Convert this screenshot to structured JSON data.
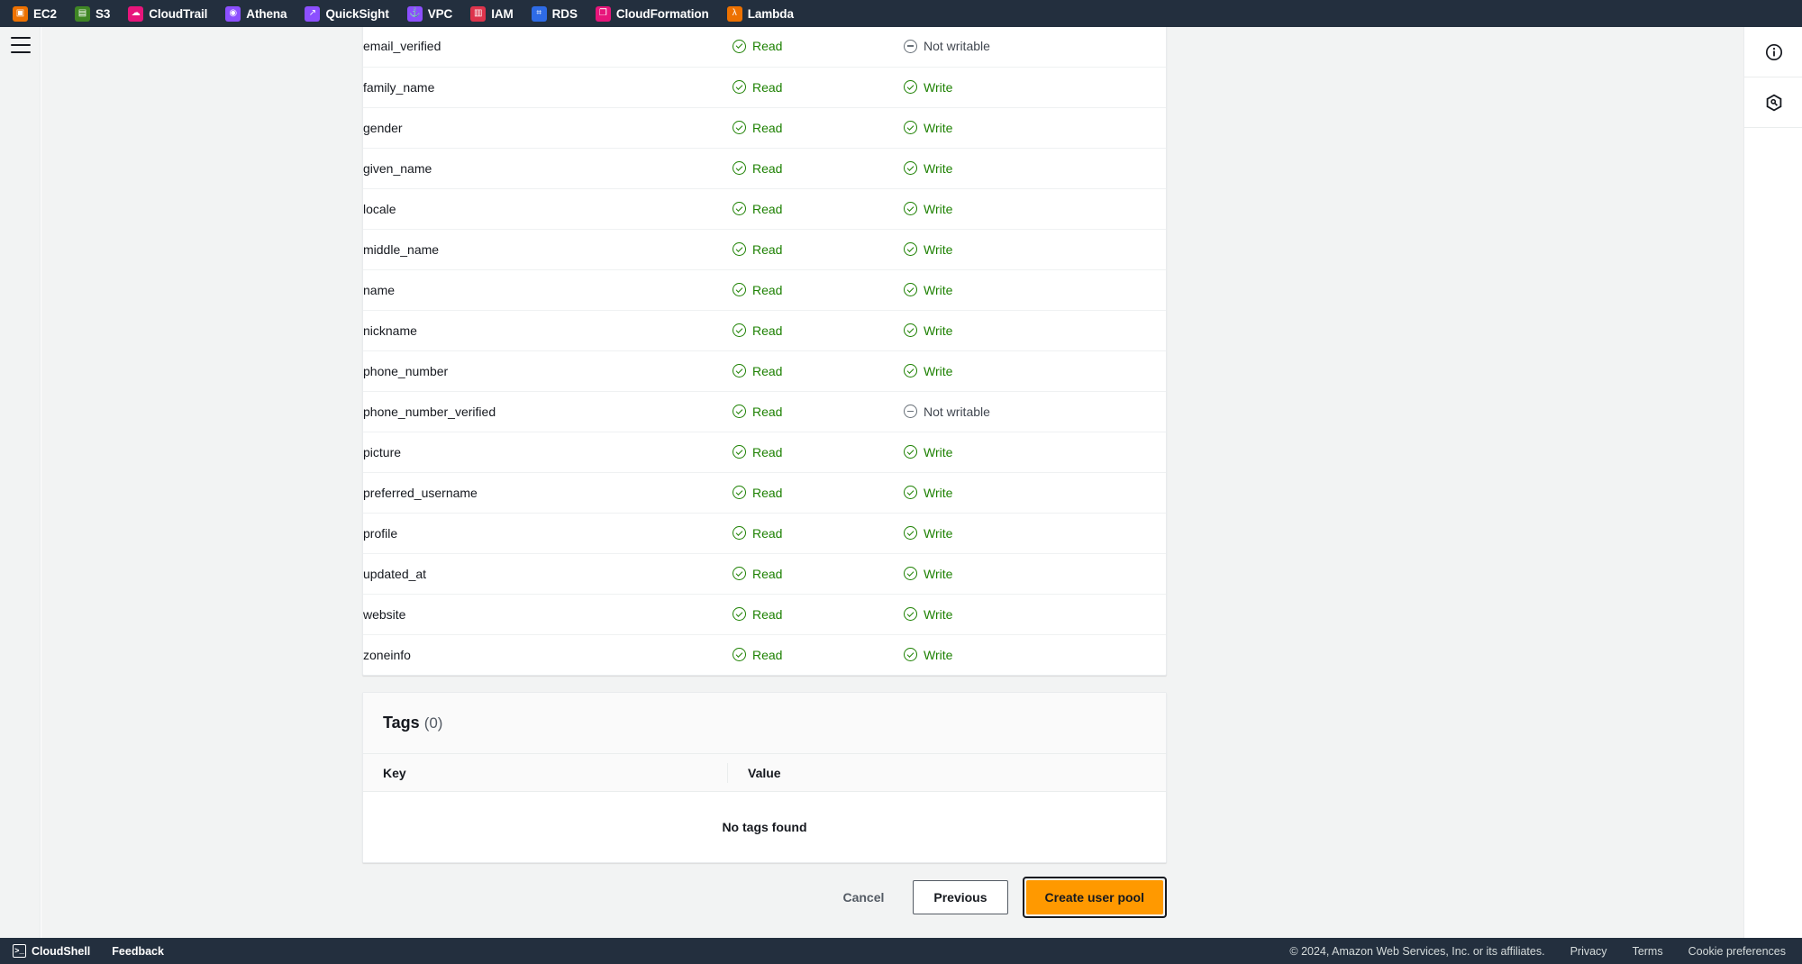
{
  "topnav": {
    "services": [
      {
        "label": "EC2",
        "icon": "ec2-icon",
        "color": "#ed7100",
        "glyph": "▣"
      },
      {
        "label": "S3",
        "icon": "s3-icon",
        "color": "#3f8624",
        "glyph": "▤"
      },
      {
        "label": "CloudTrail",
        "icon": "cloudtrail-icon",
        "color": "#e7157b",
        "glyph": "☁"
      },
      {
        "label": "Athena",
        "icon": "athena-icon",
        "color": "#8c4fff",
        "glyph": "◉"
      },
      {
        "label": "QuickSight",
        "icon": "quicksight-icon",
        "color": "#8c4fff",
        "glyph": "↗"
      },
      {
        "label": "VPC",
        "icon": "vpc-icon",
        "color": "#8c4fff",
        "glyph": "⚓"
      },
      {
        "label": "IAM",
        "icon": "iam-icon",
        "color": "#dd344c",
        "glyph": "▥"
      },
      {
        "label": "RDS",
        "icon": "rds-icon",
        "color": "#2e6be6",
        "glyph": "⌗"
      },
      {
        "label": "CloudFormation",
        "icon": "cloudformation-icon",
        "color": "#e7157b",
        "glyph": "❐"
      },
      {
        "label": "Lambda",
        "icon": "lambda-icon",
        "color": "#ed7100",
        "glyph": "λ"
      }
    ]
  },
  "left_rail": {
    "menu_icon": "hamburger-menu-icon"
  },
  "right_rail": {
    "items": [
      {
        "icon": "info-circle-icon",
        "glyph": "i"
      },
      {
        "icon": "security-shield-icon",
        "glyph": "⬡"
      }
    ]
  },
  "attributes_table": {
    "read_label": "Read",
    "write_label": "Write",
    "not_writable_label": "Not writable",
    "rows": [
      {
        "name": "email_verified",
        "read": "Read",
        "write": "Not writable",
        "writable": false
      },
      {
        "name": "family_name",
        "read": "Read",
        "write": "Write",
        "writable": true
      },
      {
        "name": "gender",
        "read": "Read",
        "write": "Write",
        "writable": true
      },
      {
        "name": "given_name",
        "read": "Read",
        "write": "Write",
        "writable": true
      },
      {
        "name": "locale",
        "read": "Read",
        "write": "Write",
        "writable": true
      },
      {
        "name": "middle_name",
        "read": "Read",
        "write": "Write",
        "writable": true
      },
      {
        "name": "name",
        "read": "Read",
        "write": "Write",
        "writable": true
      },
      {
        "name": "nickname",
        "read": "Read",
        "write": "Write",
        "writable": true
      },
      {
        "name": "phone_number",
        "read": "Read",
        "write": "Write",
        "writable": true
      },
      {
        "name": "phone_number_verified",
        "read": "Read",
        "write": "Not writable",
        "writable": false
      },
      {
        "name": "picture",
        "read": "Read",
        "write": "Write",
        "writable": true
      },
      {
        "name": "preferred_username",
        "read": "Read",
        "write": "Write",
        "writable": true
      },
      {
        "name": "profile",
        "read": "Read",
        "write": "Write",
        "writable": true
      },
      {
        "name": "updated_at",
        "read": "Read",
        "write": "Write",
        "writable": true
      },
      {
        "name": "website",
        "read": "Read",
        "write": "Write",
        "writable": true
      },
      {
        "name": "zoneinfo",
        "read": "Read",
        "write": "Write",
        "writable": true
      }
    ]
  },
  "tags": {
    "title": "Tags",
    "count": "(0)",
    "col_key": "Key",
    "col_value": "Value",
    "empty_message": "No tags found"
  },
  "actions": {
    "cancel_label": "Cancel",
    "previous_label": "Previous",
    "create_label": "Create user pool",
    "primary_color": "#ff9900"
  },
  "footer": {
    "cloudshell_label": "CloudShell",
    "feedback_label": "Feedback",
    "copyright": "© 2024, Amazon Web Services, Inc. or its affiliates.",
    "privacy_label": "Privacy",
    "terms_label": "Terms",
    "cookie_label": "Cookie preferences"
  }
}
